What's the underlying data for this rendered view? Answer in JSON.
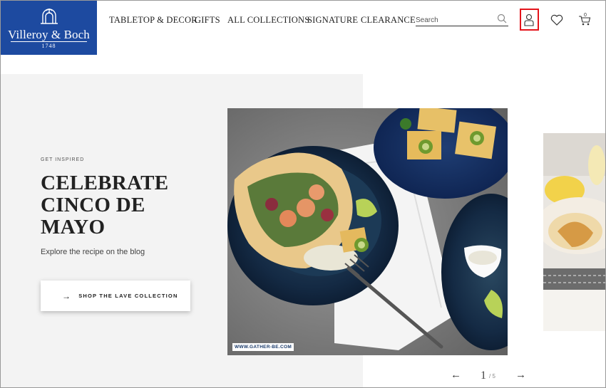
{
  "brand": {
    "name": "Villeroy & Boch",
    "year": "1748",
    "color": "#1d4aa0"
  },
  "nav": {
    "items": [
      {
        "label": "TABLETOP & DECOR"
      },
      {
        "label": "GIFTS"
      },
      {
        "label": "ALL COLLECTIONS"
      },
      {
        "label": "SIGNATURE"
      },
      {
        "label": "CLEARANCE"
      }
    ]
  },
  "search": {
    "placeholder": "Search",
    "icon": "search-icon"
  },
  "header_icons": {
    "account": "account-icon",
    "wishlist": "heart-icon",
    "cart": "cart-icon",
    "cart_count": "0",
    "highlight_color": "#e4141b"
  },
  "hero": {
    "eyebrow": "GET INSPIRED",
    "headline": "CELEBRATE CINCO DE MAYO",
    "subtitle": "Explore the recipe on the blog",
    "cta_arrow": "→",
    "cta_label": "SHOP THE LAVE COLLECTION",
    "watermark": "WWW.GATHER-BE.COM"
  },
  "pager": {
    "prev": "←",
    "current": "1",
    "total": "/ 5",
    "next": "→"
  }
}
